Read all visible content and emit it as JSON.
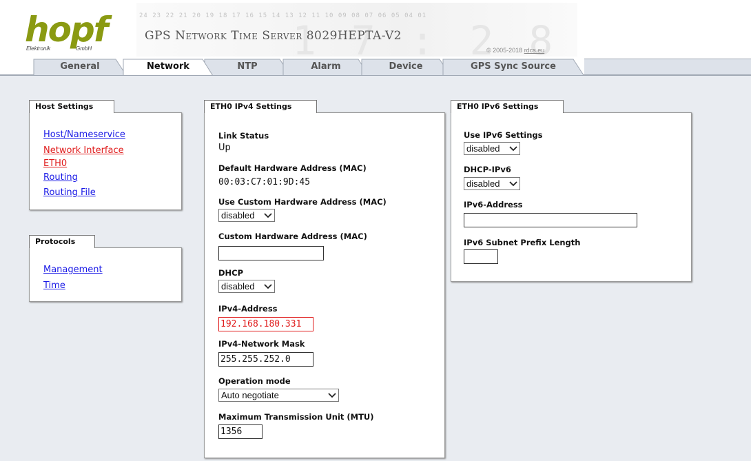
{
  "brand": {
    "logo": "hopf",
    "logo_sub_left": "Elektronik",
    "logo_sub_right": "GmbH",
    "product_title": "GPS Network Time Server 8029HEPTA-V2",
    "banner_digits": "24 23 22 21 20 19 18 17 16 15 14 13 12 11 10 09 08 07 06 05 04 01",
    "copyright_prefix": "© 2005-2018",
    "copyright_link": "rdcs.eu"
  },
  "tabs": [
    {
      "label": "General"
    },
    {
      "label": "Network"
    },
    {
      "label": "NTP"
    },
    {
      "label": "Alarm"
    },
    {
      "label": "Device"
    },
    {
      "label": "GPS Sync Source"
    }
  ],
  "active_tab": "Network",
  "host_settings": {
    "title": "Host Settings",
    "links": [
      {
        "label": "Host/Nameservice"
      },
      {
        "label": "Network Interface"
      },
      {
        "label": "ETH0"
      },
      {
        "label": "Routing"
      },
      {
        "label": "Routing File"
      }
    ]
  },
  "protocols": {
    "title": "Protocols",
    "links": [
      {
        "label": "Management"
      },
      {
        "label": "Time"
      }
    ]
  },
  "ipv4": {
    "title": "ETH0 IPv4 Settings",
    "link_status_label": "Link Status",
    "link_status_value": "Up",
    "default_mac_label": "Default Hardware Address (MAC)",
    "default_mac_value": "00:03:C7:01:9D:45",
    "use_custom_mac_label": "Use Custom Hardware Address (MAC)",
    "use_custom_mac_value": "disabled",
    "custom_mac_label": "Custom Hardware Address (MAC)",
    "custom_mac_value": "",
    "dhcp_label": "DHCP",
    "dhcp_value": "disabled",
    "ipv4_address_label": "IPv4-Address",
    "ipv4_address_value": "192.168.180.331",
    "netmask_label": "IPv4-Network Mask",
    "netmask_value": "255.255.252.0",
    "opmode_label": "Operation mode",
    "opmode_value": "Auto negotiate",
    "mtu_label": "Maximum Transmission Unit (MTU)",
    "mtu_value": "1356"
  },
  "ipv6": {
    "title": "ETH0 IPv6 Settings",
    "use_ipv6_label": "Use IPv6 Settings",
    "use_ipv6_value": "disabled",
    "dhcp_ipv6_label": "DHCP-IPv6",
    "dhcp_ipv6_value": "disabled",
    "ipv6_address_label": "IPv6-Address",
    "ipv6_address_value": "",
    "prefix_label": "IPv6 Subnet Prefix Length",
    "prefix_value": ""
  },
  "colors": {
    "link": "#1a1ae6",
    "link_active": "#e01c1c",
    "error": "#e01c1c",
    "logo_green": "#8a9a12",
    "content_bg": "#e9ecf1"
  }
}
